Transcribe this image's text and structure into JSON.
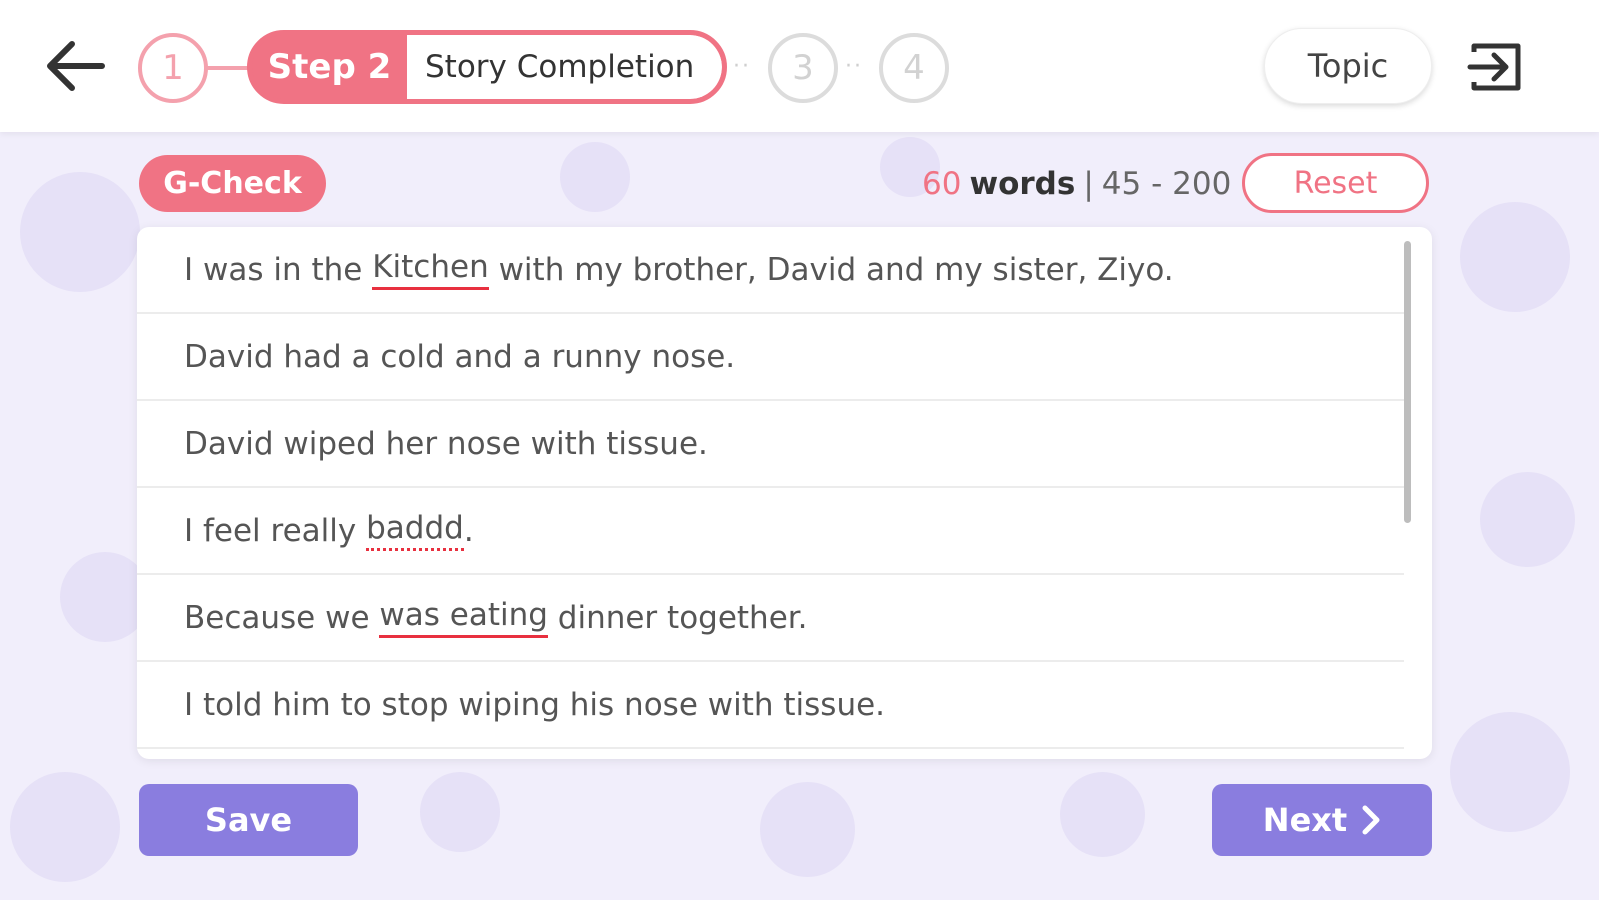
{
  "header": {
    "steps": [
      {
        "number": "1",
        "state": "completed"
      },
      {
        "number": "3",
        "state": "pending"
      },
      {
        "number": "4",
        "state": "pending"
      }
    ],
    "active_step": {
      "label": "Step 2",
      "name": "Story Completion"
    },
    "topic_label": "Topic"
  },
  "toolbar": {
    "gcheck_label": "G-Check",
    "word_count": {
      "count": "60",
      "label": "words",
      "separator": "|",
      "range": "45 - 200"
    },
    "reset_label": "Reset"
  },
  "story": {
    "lines": [
      [
        {
          "text": "I was in the ",
          "mark": ""
        },
        {
          "text": "Kitchen",
          "mark": "grammar"
        },
        {
          "text": " with my brother, David and my sister, Ziyo.",
          "mark": ""
        }
      ],
      [
        {
          "text": "David had a cold and a runny nose.",
          "mark": ""
        }
      ],
      [
        {
          "text": "David wiped her nose with tissue.",
          "mark": ""
        }
      ],
      [
        {
          "text": "I feel really ",
          "mark": ""
        },
        {
          "text": "baddd",
          "mark": "spelling"
        },
        {
          "text": ".",
          "mark": ""
        }
      ],
      [
        {
          "text": "Because we ",
          "mark": ""
        },
        {
          "text": "was eating",
          "mark": "grammar"
        },
        {
          "text": " dinner together.",
          "mark": ""
        }
      ],
      [
        {
          "text": "I told him to stop wiping his nose with tissue.",
          "mark": ""
        }
      ]
    ]
  },
  "footer": {
    "save_label": "Save",
    "next_label": "Next"
  },
  "colors": {
    "accent_pink": "#f07384",
    "accent_purple": "#8a7ddf",
    "error_red": "#e8303f",
    "background": "#f1eefb"
  },
  "icons": [
    "back-arrow-icon",
    "exit-icon",
    "chevron-right-icon"
  ]
}
